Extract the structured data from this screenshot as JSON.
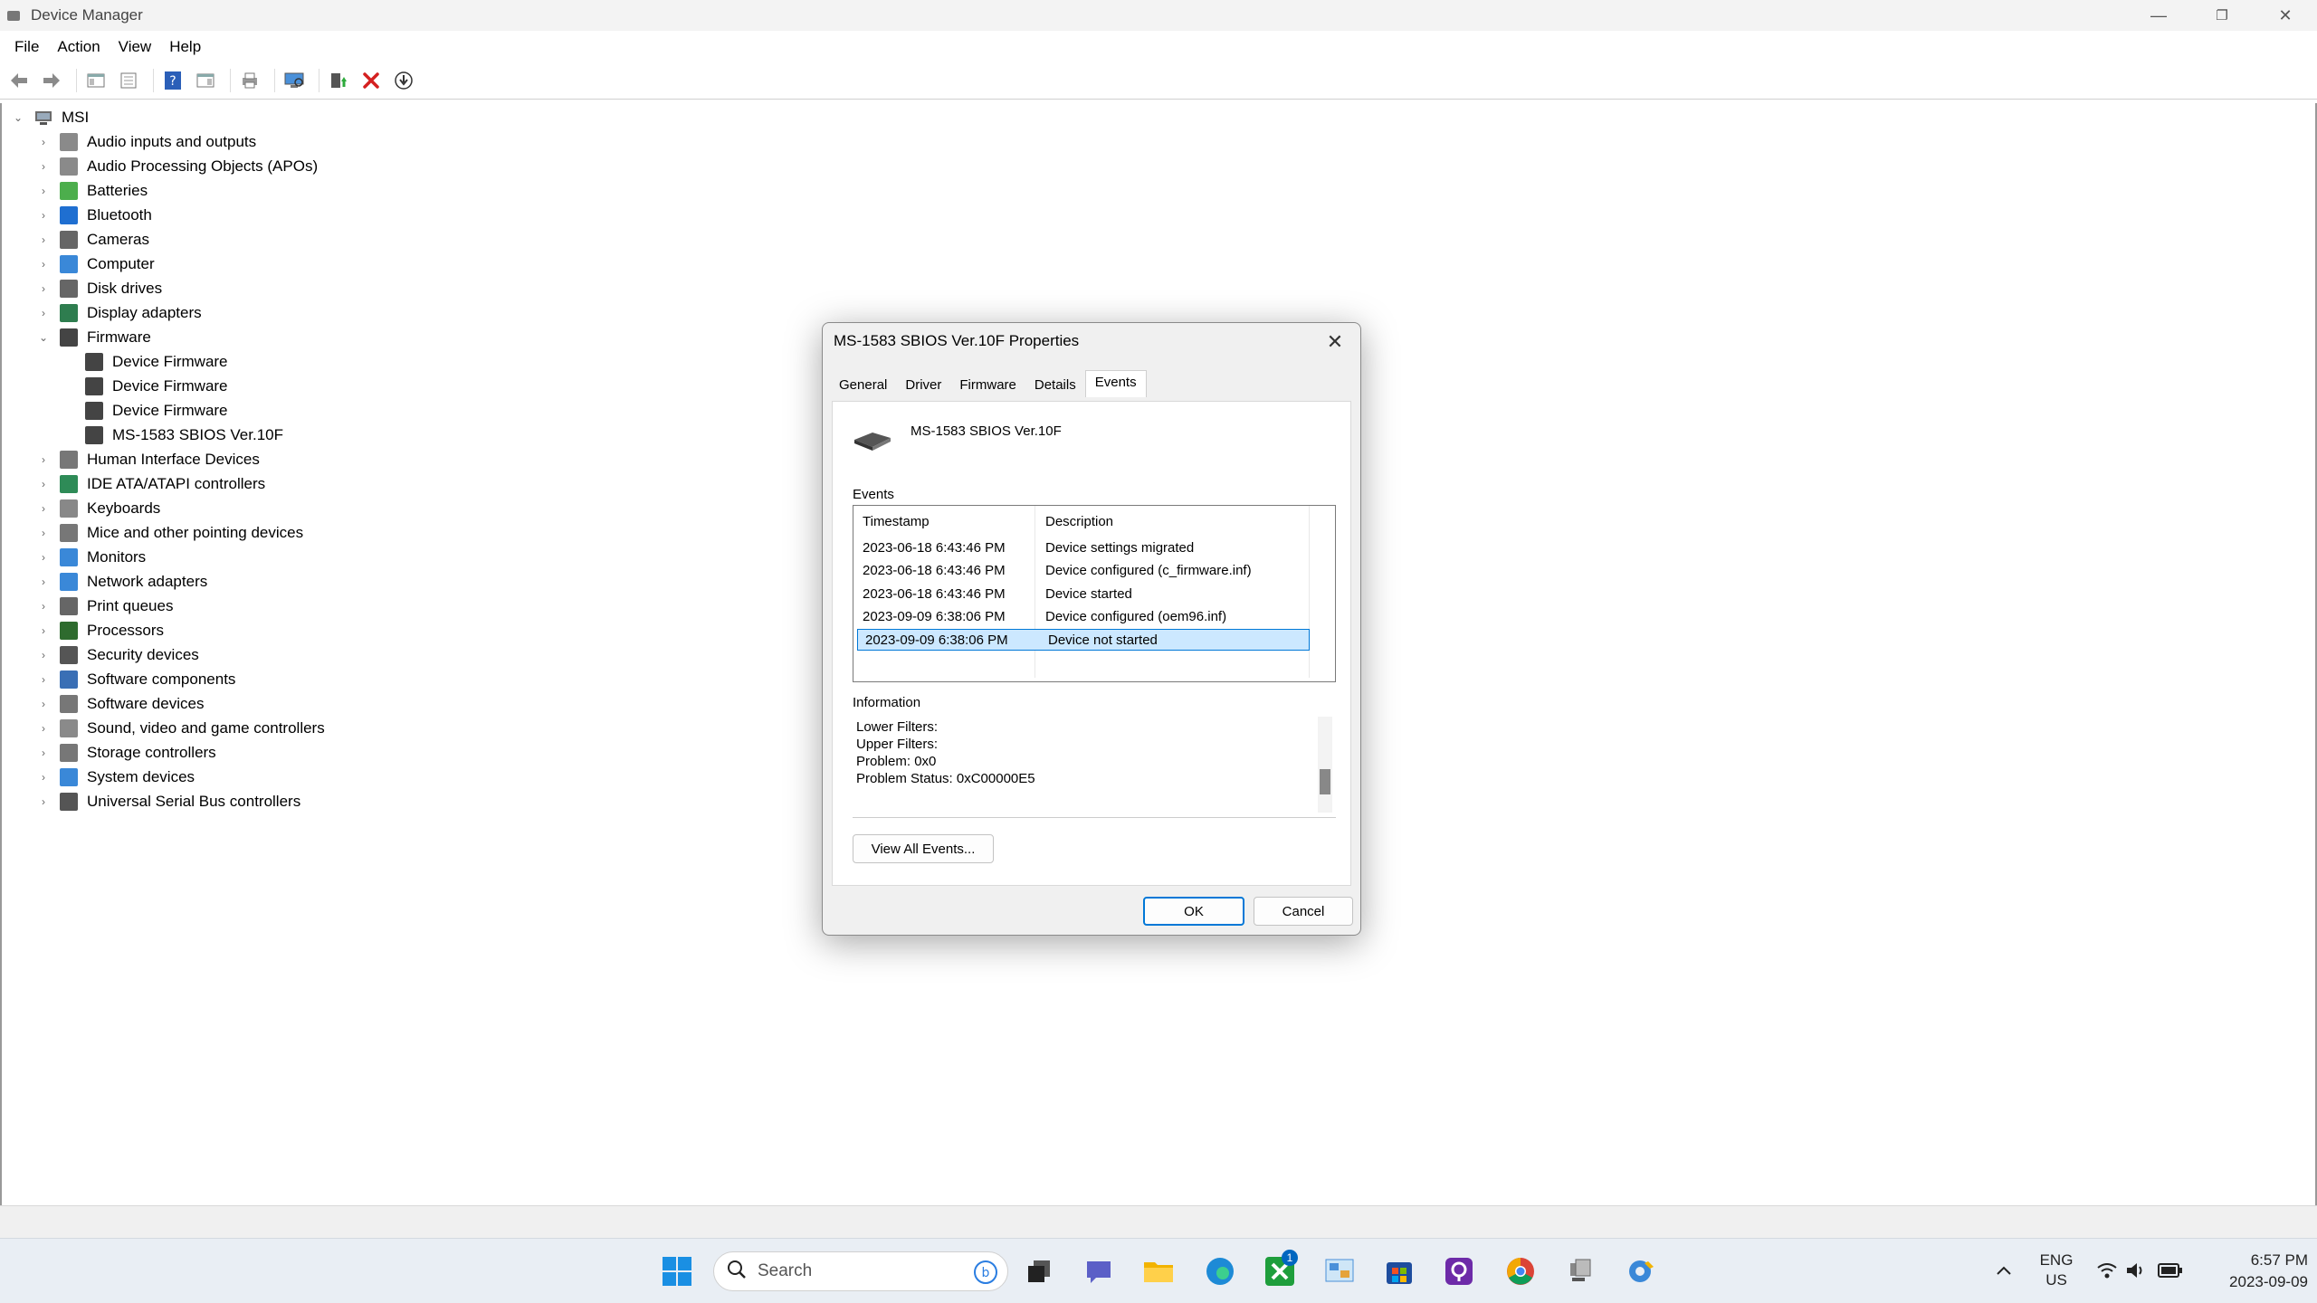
{
  "window": {
    "title": "Device Manager",
    "minimize_glyph": "—",
    "restore_glyph": "❐",
    "close_glyph": "✕"
  },
  "menu": [
    "File",
    "Action",
    "View",
    "Help"
  ],
  "toolbar_icons": [
    "back-icon",
    "forward-icon",
    "show-hide-console-tree-icon",
    "properties-icon",
    "help-icon",
    "action-pane-icon",
    "print-icon",
    "scan-hardware-icon",
    "update-driver-icon",
    "uninstall-icon",
    "disable-device-icon"
  ],
  "tree": {
    "root": "MSI",
    "items": [
      {
        "label": "Audio inputs and outputs",
        "icon": "speaker-icon",
        "expanded": false
      },
      {
        "label": "Audio Processing Objects (APOs)",
        "icon": "speaker-icon",
        "expanded": false
      },
      {
        "label": "Batteries",
        "icon": "battery-icon",
        "expanded": false
      },
      {
        "label": "Bluetooth",
        "icon": "bluetooth-icon",
        "expanded": false
      },
      {
        "label": "Cameras",
        "icon": "camera-icon",
        "expanded": false
      },
      {
        "label": "Computer",
        "icon": "monitor-icon",
        "expanded": false
      },
      {
        "label": "Disk drives",
        "icon": "disk-icon",
        "expanded": false
      },
      {
        "label": "Display adapters",
        "icon": "display-adapter-icon",
        "expanded": false
      },
      {
        "label": "Firmware",
        "icon": "chip-icon",
        "expanded": true,
        "children": [
          "Device Firmware",
          "Device Firmware",
          "Device Firmware",
          "MS-1583 SBIOS Ver.10F"
        ]
      },
      {
        "label": "Human Interface Devices",
        "icon": "hid-icon",
        "expanded": false
      },
      {
        "label": "IDE ATA/ATAPI controllers",
        "icon": "ide-icon",
        "expanded": false
      },
      {
        "label": "Keyboards",
        "icon": "keyboard-icon",
        "expanded": false
      },
      {
        "label": "Mice and other pointing devices",
        "icon": "mouse-icon",
        "expanded": false
      },
      {
        "label": "Monitors",
        "icon": "monitor-icon",
        "expanded": false
      },
      {
        "label": "Network adapters",
        "icon": "network-icon",
        "expanded": false
      },
      {
        "label": "Print queues",
        "icon": "printer-icon",
        "expanded": false
      },
      {
        "label": "Processors",
        "icon": "processor-icon",
        "expanded": false
      },
      {
        "label": "Security devices",
        "icon": "security-icon",
        "expanded": false
      },
      {
        "label": "Software components",
        "icon": "software-component-icon",
        "expanded": false
      },
      {
        "label": "Software devices",
        "icon": "software-device-icon",
        "expanded": false
      },
      {
        "label": "Sound, video and game controllers",
        "icon": "speaker-icon",
        "expanded": false
      },
      {
        "label": "Storage controllers",
        "icon": "storage-icon",
        "expanded": false
      },
      {
        "label": "System devices",
        "icon": "system-icon",
        "expanded": false
      },
      {
        "label": "Universal Serial Bus controllers",
        "icon": "usb-icon",
        "expanded": false
      }
    ]
  },
  "dialog": {
    "title": "MS-1583 SBIOS Ver.10F Properties",
    "tabs": [
      "General",
      "Driver",
      "Firmware",
      "Details",
      "Events"
    ],
    "active_tab": "Events",
    "device_name": "MS-1583 SBIOS Ver.10F",
    "events_label": "Events",
    "columns": [
      "Timestamp",
      "Description"
    ],
    "events": [
      {
        "timestamp": "2023-06-18 6:43:46 PM",
        "description": "Device settings migrated"
      },
      {
        "timestamp": "2023-06-18 6:43:46 PM",
        "description": "Device configured (c_firmware.inf)"
      },
      {
        "timestamp": "2023-06-18 6:43:46 PM",
        "description": "Device started"
      },
      {
        "timestamp": "2023-09-09 6:38:06 PM",
        "description": "Device configured (oem96.inf)"
      },
      {
        "timestamp": "2023-09-09 6:38:06 PM",
        "description": "Device not started",
        "selected": true
      }
    ],
    "information_label": "Information",
    "information_lines": [
      "Lower Filters:",
      "Upper Filters:",
      "Problem: 0x0",
      "Problem Status: 0xC00000E5"
    ],
    "view_all_button": "View All Events...",
    "ok_button": "OK",
    "cancel_button": "Cancel"
  },
  "taskbar": {
    "search_placeholder": "Search",
    "apps": [
      "start-icon",
      "task-view-icon",
      "teams-chat-icon",
      "file-explorer-icon",
      "edge-icon",
      "xbox-icon",
      "control-panel-icon",
      "store-icon",
      "app-icon",
      "chrome-icon",
      "device-manager-icon",
      "settings-icon"
    ],
    "xbox_badge": "1",
    "language": "ENG",
    "region": "US",
    "time": "6:57 PM",
    "date": "2023-09-09"
  }
}
